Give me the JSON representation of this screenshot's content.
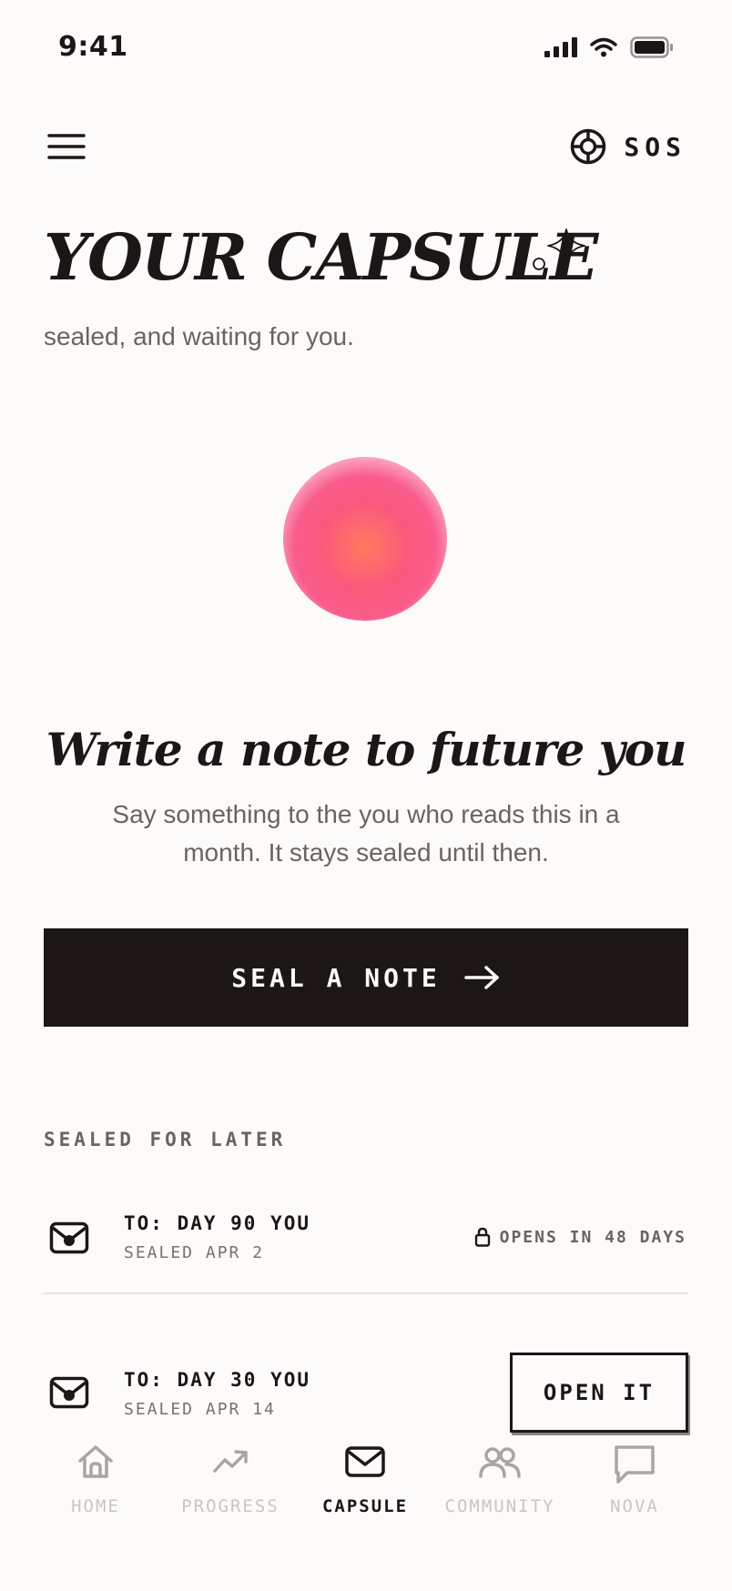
{
  "status_bar": {
    "time": "9:41"
  },
  "top_nav": {
    "sos_label": "SOS"
  },
  "header": {
    "title": "YOUR CAPSULE",
    "subtitle": "sealed, and waiting for you."
  },
  "prompt": {
    "title": "Write a note to future you",
    "body": "Say something to the you who reads this in a month. It stays sealed until then."
  },
  "primary_action": {
    "label": "SEAL A NOTE"
  },
  "sealed_section": {
    "label": "SEALED FOR LATER",
    "notes": [
      {
        "to": "TO: DAY 90 YOU",
        "sealed": "SEALED APR 2",
        "status": "OPENS IN 48 DAYS"
      },
      {
        "to": "TO: DAY 30 YOU",
        "sealed": "SEALED APR 14",
        "action": "OPEN IT"
      }
    ]
  },
  "tab_bar": {
    "tabs": [
      {
        "label": "HOME",
        "icon": "home-icon"
      },
      {
        "label": "PROGRESS",
        "icon": "trend-up-icon"
      },
      {
        "label": "CAPSULE",
        "icon": "envelope-icon",
        "active": true
      },
      {
        "label": "COMMUNITY",
        "icon": "people-icon"
      },
      {
        "label": "NOVA",
        "icon": "chat-bubble-icon"
      }
    ]
  },
  "colors": {
    "background": "#fcfbf9",
    "ink": "#1b1716",
    "muted_text": "#6d635b",
    "inactive_tab": "#c9c5c2",
    "orb_core": "#ff7a5e",
    "orb_edge": "#f95c8b"
  }
}
